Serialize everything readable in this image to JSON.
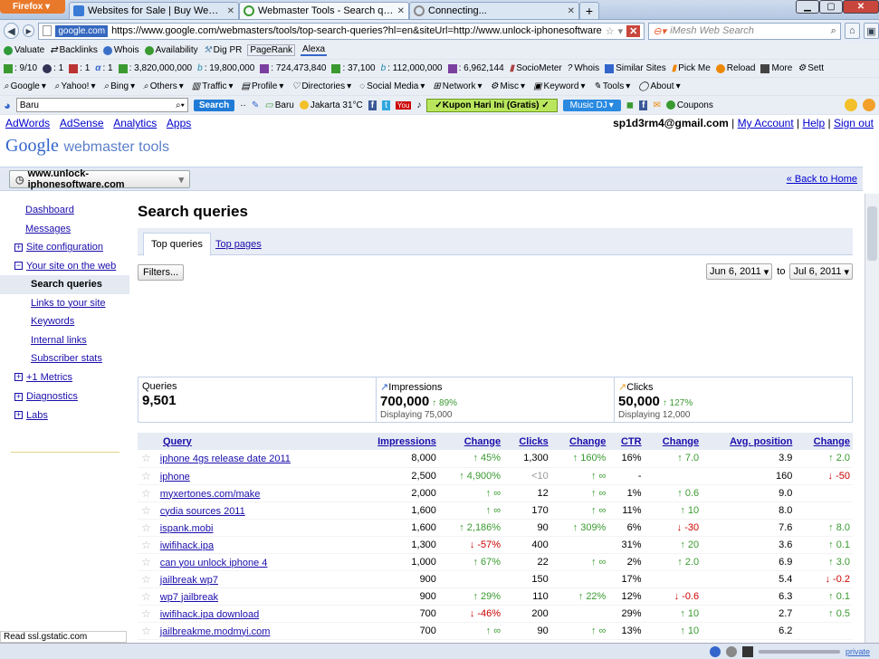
{
  "browser": {
    "firefox_label": "Firefox",
    "tabs": [
      {
        "title": "Websites for Sale | Buy Websites for S..."
      },
      {
        "title": "Webmaster Tools - Search queries"
      },
      {
        "title": "Connecting..."
      }
    ],
    "new_tab": "+",
    "site_badge": "google.com",
    "url": "https://www.google.com/webmasters/tools/top-search-queries?hl=en&siteUrl=http://www.unlock-iphonesoftware.com/",
    "search_placeholder": "iMesh Web Search"
  },
  "toolbar1": {
    "items": [
      "Valuate",
      "Backlinks",
      "Whois",
      "Availability",
      "Dig PR",
      "PageRank",
      "Alexa"
    ]
  },
  "toolbar2": {
    "items": [
      ": 9/10",
      ": 1",
      ": 1",
      ": 1",
      ": 3,820,000,000",
      ": 19,800,000",
      ": 724,473,840",
      ": 37,100",
      ": 112,000,000",
      ": 6,962,144",
      "SocioMeter",
      "Whois",
      "Similar Sites",
      "Pick Me",
      "Reload",
      "More",
      "Sett"
    ]
  },
  "toolbar3": {
    "items": [
      "Google",
      "Yahoo!",
      "Bing",
      "Others",
      "Traffic",
      "Profile",
      "Directories",
      "Social Media",
      "Network",
      "Misc",
      "Keyword",
      "Tools",
      "About"
    ]
  },
  "toolbar4": {
    "search_value": "Baru",
    "search_button": "Search",
    "baru": "Baru",
    "weather": "Jakarta 31°C",
    "kupon": "✓Kupon Hari Ini (Gratis) ✓",
    "musicdj": "Music DJ",
    "coupons": "Coupons"
  },
  "gbar": {
    "links": [
      "AdWords",
      "AdSense",
      "Analytics",
      "Apps"
    ],
    "email": "sp1d3rm4@gmail.com",
    "my_account": "My Account",
    "help": "Help",
    "sign_out": "Sign out"
  },
  "logo": {
    "google": "Google",
    "product": "webmaster tools"
  },
  "site": {
    "selected": "www.unlock-iphonesoftware.com",
    "back_home": "« Back to Home"
  },
  "sidebar": {
    "dashboard": "Dashboard",
    "messages": "Messages",
    "site_configuration": "Site configuration",
    "your_site_on_web": "Your site on the web",
    "sub": [
      "Search queries",
      "Links to your site",
      "Keywords",
      "Internal links",
      "Subscriber stats"
    ],
    "plus1_metrics": "+1 Metrics",
    "diagnostics": "Diagnostics",
    "labs": "Labs"
  },
  "main": {
    "title": "Search queries",
    "tab_top_queries": "Top queries",
    "tab_top_pages": "Top pages",
    "filters": "Filters...",
    "date_from": "Jun 6, 2011",
    "date_to_label": "to",
    "date_to": "Jul 6, 2011"
  },
  "stats": {
    "queries_label": "Queries",
    "queries": "9,501",
    "impressions_label": "Impressions",
    "impressions": "700,000",
    "impressions_change": "89%",
    "impressions_displaying": "Displaying 75,000",
    "clicks_label": "Clicks",
    "clicks": "50,000",
    "clicks_change": "127%",
    "clicks_displaying": "Displaying 12,000"
  },
  "table": {
    "headers": {
      "query": "Query",
      "impressions": "Impressions",
      "change": "Change",
      "clicks": "Clicks",
      "change2": "Change",
      "ctr": "CTR",
      "change3": "Change",
      "avg_position": "Avg. position",
      "change4": "Change"
    },
    "rows": [
      {
        "query": "iphone 4gs release date 2011",
        "impressions": "8,000",
        "imp_change": "45%",
        "imp_dir": "up",
        "clicks": "1,300",
        "clk_change": "160%",
        "clk_dir": "up",
        "ctr": "16%",
        "ctr_change": "7.0",
        "ctr_dir": "up",
        "pos": "3.9",
        "pos_change": "2.0",
        "pos_dir": "up"
      },
      {
        "query": "iphone",
        "impressions": "2,500",
        "imp_change": "4,900%",
        "imp_dir": "up",
        "clicks": "<10",
        "clk_change": "∞",
        "clk_dir": "up",
        "ctr": "-",
        "ctr_change": "",
        "ctr_dir": "",
        "pos": "160",
        "pos_change": "-50",
        "pos_dir": "dn"
      },
      {
        "query": "myxertones.com/make",
        "impressions": "2,000",
        "imp_change": "∞",
        "imp_dir": "up",
        "clicks": "12",
        "clk_change": "∞",
        "clk_dir": "up",
        "ctr": "1%",
        "ctr_change": "0.6",
        "ctr_dir": "up",
        "pos": "9.0",
        "pos_change": "",
        "pos_dir": ""
      },
      {
        "query": "cydia sources 2011",
        "impressions": "1,600",
        "imp_change": "∞",
        "imp_dir": "up",
        "clicks": "170",
        "clk_change": "∞",
        "clk_dir": "up",
        "ctr": "11%",
        "ctr_change": "10",
        "ctr_dir": "up",
        "pos": "8.0",
        "pos_change": "",
        "pos_dir": ""
      },
      {
        "query": "ispank.mobi",
        "impressions": "1,600",
        "imp_change": "2,186%",
        "imp_dir": "up",
        "clicks": "90",
        "clk_change": "309%",
        "clk_dir": "up",
        "ctr": "6%",
        "ctr_change": "-30",
        "ctr_dir": "dn",
        "pos": "7.6",
        "pos_change": "8.0",
        "pos_dir": "up"
      },
      {
        "query": "iwifihack.ipa",
        "impressions": "1,300",
        "imp_change": "-57%",
        "imp_dir": "dn",
        "clicks": "400",
        "clk_change": "",
        "clk_dir": "",
        "ctr": "31%",
        "ctr_change": "20",
        "ctr_dir": "up",
        "pos": "3.6",
        "pos_change": "0.1",
        "pos_dir": "up"
      },
      {
        "query": "can you unlock iphone 4",
        "impressions": "1,000",
        "imp_change": "67%",
        "imp_dir": "up",
        "clicks": "22",
        "clk_change": "∞",
        "clk_dir": "up",
        "ctr": "2%",
        "ctr_change": "2.0",
        "ctr_dir": "up",
        "pos": "6.9",
        "pos_change": "3.0",
        "pos_dir": "up"
      },
      {
        "query": "jailbreak wp7",
        "impressions": "900",
        "imp_change": "",
        "imp_dir": "",
        "clicks": "150",
        "clk_change": "",
        "clk_dir": "",
        "ctr": "17%",
        "ctr_change": "",
        "ctr_dir": "",
        "pos": "5.4",
        "pos_change": "-0.2",
        "pos_dir": "dn"
      },
      {
        "query": "wp7 jailbreak",
        "impressions": "900",
        "imp_change": "29%",
        "imp_dir": "up",
        "clicks": "110",
        "clk_change": "22%",
        "clk_dir": "up",
        "ctr": "12%",
        "ctr_change": "-0.6",
        "ctr_dir": "dn",
        "pos": "6.3",
        "pos_change": "0.1",
        "pos_dir": "up"
      },
      {
        "query": "iwifihack.ipa download",
        "impressions": "700",
        "imp_change": "-46%",
        "imp_dir": "dn",
        "clicks": "200",
        "clk_change": "",
        "clk_dir": "",
        "ctr": "29%",
        "ctr_change": "10",
        "ctr_dir": "up",
        "pos": "2.7",
        "pos_change": "0.5",
        "pos_dir": "up"
      },
      {
        "query": "jailbreakme.modmyi.com",
        "impressions": "700",
        "imp_change": "∞",
        "imp_dir": "up",
        "clicks": "90",
        "clk_change": "∞",
        "clk_dir": "up",
        "ctr": "13%",
        "ctr_change": "10",
        "ctr_dir": "up",
        "pos": "6.2",
        "pos_change": "",
        "pos_dir": ""
      }
    ]
  },
  "statusbar": {
    "text": "Read ssl.gstatic.com",
    "private": "private"
  }
}
